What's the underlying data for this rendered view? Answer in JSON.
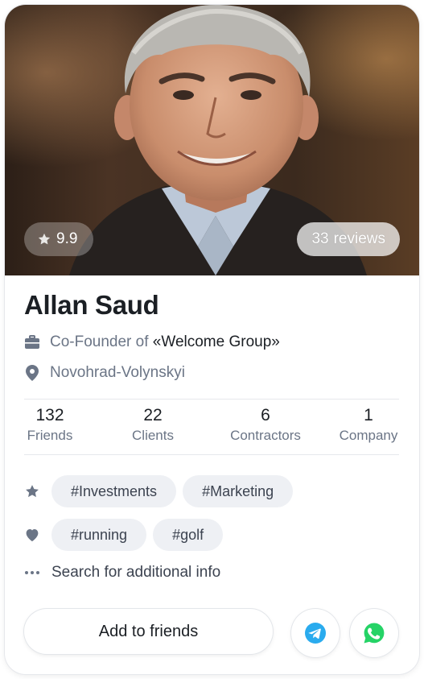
{
  "profile": {
    "name": "Allan Saud",
    "rating": "9.9",
    "reviews_count": "33",
    "reviews_word": "reviews",
    "job_prefix": "Co-Founder of",
    "company": "«Welcome Group»",
    "location": "Novohrad-Volynskyi"
  },
  "stats": [
    {
      "value": "132",
      "label": "Friends"
    },
    {
      "value": "22",
      "label": "Clients"
    },
    {
      "value": "6",
      "label": "Contractors"
    },
    {
      "value": "1",
      "label": "Company"
    }
  ],
  "interests": {
    "professional": [
      "#Investments",
      "#Marketing"
    ],
    "hobbies": [
      "#running",
      "#golf"
    ]
  },
  "search_label": "Search for additional info",
  "actions": {
    "add_friend_label": "Add to friends"
  },
  "icons": {
    "rating": "star-icon",
    "job": "briefcase-icon",
    "location": "location-pin-icon",
    "professional": "star-icon",
    "hobbies": "heart-icon",
    "more": "ellipsis-icon",
    "telegram": "telegram-icon",
    "whatsapp": "whatsapp-icon"
  },
  "colors": {
    "telegram": "#2AABEE",
    "whatsapp": "#25D366",
    "muted_icon": "#6b7586",
    "tag_bg": "#eef0f4"
  }
}
